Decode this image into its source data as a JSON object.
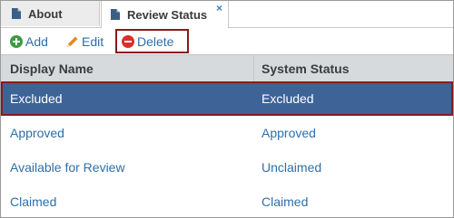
{
  "tabs": [
    {
      "label": "About"
    },
    {
      "label": "Review Status",
      "close": "×"
    }
  ],
  "toolbar": {
    "add_label": "Add",
    "edit_label": "Edit",
    "delete_label": "Delete"
  },
  "grid": {
    "columns": [
      "Display Name",
      "System Status"
    ],
    "rows": [
      {
        "display_name": "Excluded",
        "system_status": "Excluded",
        "selected": true
      },
      {
        "display_name": "Approved",
        "system_status": "Approved"
      },
      {
        "display_name": "Available for Review",
        "system_status": "Unclaimed"
      },
      {
        "display_name": "Claimed",
        "system_status": "Claimed"
      }
    ]
  },
  "colors": {
    "link": "#2f6fa8",
    "selected_row": "#3d6397",
    "highlight_border": "#8b1a1a",
    "add_icon": "#3f9a3f",
    "edit_icon": "#e08a1e",
    "delete_icon": "#d9302a"
  },
  "icons": {
    "tab": "document-icon",
    "add": "plus-circle-icon",
    "edit": "pencil-icon",
    "delete": "minus-circle-icon"
  }
}
